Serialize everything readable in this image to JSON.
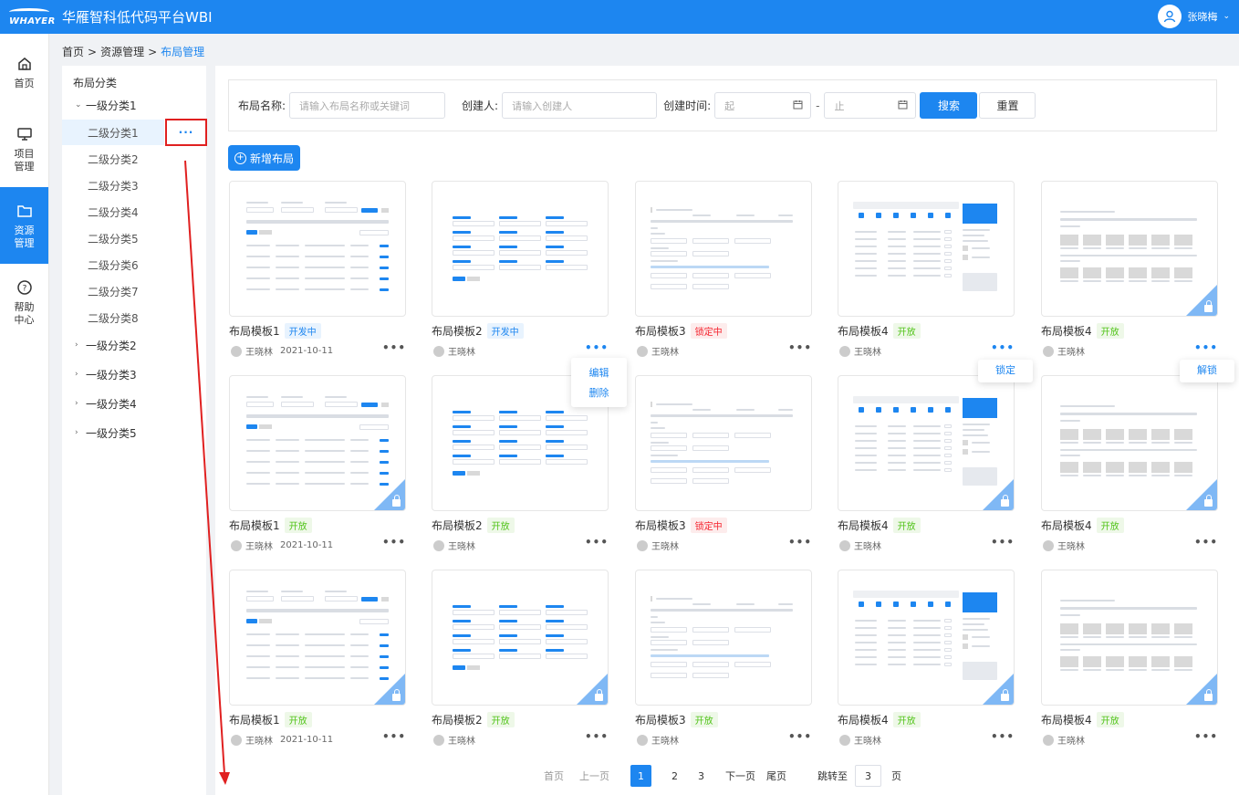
{
  "header": {
    "logo_text": "WHAYER",
    "title": "华雁智科低代码平台WBI",
    "user_name": "张晓梅"
  },
  "leftnav": [
    {
      "label": "首页",
      "icon": "home-icon"
    },
    {
      "label": "项目\n管理",
      "icon": "monitor-icon"
    },
    {
      "label": "资源\n管理",
      "icon": "folder-icon",
      "active": true
    },
    {
      "label": "帮助\n中心",
      "icon": "help-icon"
    }
  ],
  "breadcrumb": {
    "items": [
      "首页",
      "资源管理"
    ],
    "current": "布局管理",
    "sep": ">"
  },
  "tree": {
    "title": "布局分类",
    "level1_open": "一级分类1",
    "children": [
      "二级分类1",
      "二级分类2",
      "二级分类3",
      "二级分类4",
      "二级分类5",
      "二级分类6",
      "二级分类7",
      "二级分类8"
    ],
    "others": [
      "一级分类2",
      "一级分类3",
      "一级分类4",
      "一级分类5"
    ],
    "more_label": "···"
  },
  "filter": {
    "name_label": "布局名称:",
    "name_placeholder": "请输入布局名称或关键词",
    "creator_label": "创建人:",
    "creator_placeholder": "请输入创建人",
    "time_label": "创建时间:",
    "start_placeholder": "起",
    "end_placeholder": "止",
    "dash": "-",
    "search_label": "搜索",
    "reset_label": "重置"
  },
  "add_label": "新增布局",
  "cards": [
    {
      "title": "布局模板1",
      "tag": "开发中",
      "tag_type": "dev",
      "author": "王晓林",
      "date": "2021-10-11",
      "locked": false,
      "style": 1,
      "dots_blue": false
    },
    {
      "title": "布局模板2",
      "tag": "开发中",
      "tag_type": "dev",
      "author": "王晓林",
      "date": "",
      "locked": false,
      "style": 2,
      "dots_blue": true
    },
    {
      "title": "布局模板3",
      "tag": "锁定中",
      "tag_type": "lock",
      "author": "王晓林",
      "date": "",
      "locked": false,
      "style": 3,
      "dots_blue": false
    },
    {
      "title": "布局模板4",
      "tag": "开放",
      "tag_type": "open",
      "author": "王晓林",
      "date": "",
      "locked": false,
      "style": 4,
      "dots_blue": true
    },
    {
      "title": "布局模板4",
      "tag": "开放",
      "tag_type": "open",
      "author": "王晓林",
      "date": "",
      "locked": true,
      "style": 5,
      "dots_blue": true
    },
    {
      "title": "布局模板1",
      "tag": "开放",
      "tag_type": "open",
      "author": "王晓林",
      "date": "2021-10-11",
      "locked": true,
      "style": 1,
      "dots_blue": false
    },
    {
      "title": "布局模板2",
      "tag": "开放",
      "tag_type": "open",
      "author": "王晓林",
      "date": "",
      "locked": false,
      "style": 2,
      "dots_blue": false
    },
    {
      "title": "布局模板3",
      "tag": "锁定中",
      "tag_type": "lock",
      "author": "王晓林",
      "date": "",
      "locked": false,
      "style": 3,
      "dots_blue": false
    },
    {
      "title": "布局模板4",
      "tag": "开放",
      "tag_type": "open",
      "author": "王晓林",
      "date": "",
      "locked": true,
      "style": 4,
      "dots_blue": false
    },
    {
      "title": "布局模板4",
      "tag": "开放",
      "tag_type": "open",
      "author": "王晓林",
      "date": "",
      "locked": true,
      "style": 5,
      "dots_blue": false
    },
    {
      "title": "布局模板1",
      "tag": "开放",
      "tag_type": "open",
      "author": "王晓林",
      "date": "2021-10-11",
      "locked": true,
      "style": 1,
      "dots_blue": false
    },
    {
      "title": "布局模板2",
      "tag": "开放",
      "tag_type": "open",
      "author": "王晓林",
      "date": "",
      "locked": true,
      "style": 2,
      "dots_blue": false
    },
    {
      "title": "布局模板3",
      "tag": "开放",
      "tag_type": "open",
      "author": "王晓林",
      "date": "",
      "locked": false,
      "style": 3,
      "dots_blue": false
    },
    {
      "title": "布局模板4",
      "tag": "开放",
      "tag_type": "open",
      "author": "王晓林",
      "date": "",
      "locked": true,
      "style": 4,
      "dots_blue": false
    },
    {
      "title": "布局模板4",
      "tag": "开放",
      "tag_type": "open",
      "author": "王晓林",
      "date": "",
      "locked": true,
      "style": 5,
      "dots_blue": false
    }
  ],
  "popover_edit": {
    "edit": "编辑",
    "delete": "删除"
  },
  "popover_lock": {
    "label": "锁定"
  },
  "popover_unlock": {
    "label": "解锁"
  },
  "pager": {
    "first": "首页",
    "prev": "上一页",
    "pages": [
      "1",
      "2",
      "3"
    ],
    "current": "1",
    "next": "下一页",
    "last": "尾页",
    "jump_label": "跳转至",
    "jump_value": "3",
    "page_unit": "页"
  },
  "colors": {
    "primary": "#1d86f0",
    "annotation": "#e02020",
    "tag_lock": "#f5222d",
    "tag_open": "#52c41a"
  }
}
